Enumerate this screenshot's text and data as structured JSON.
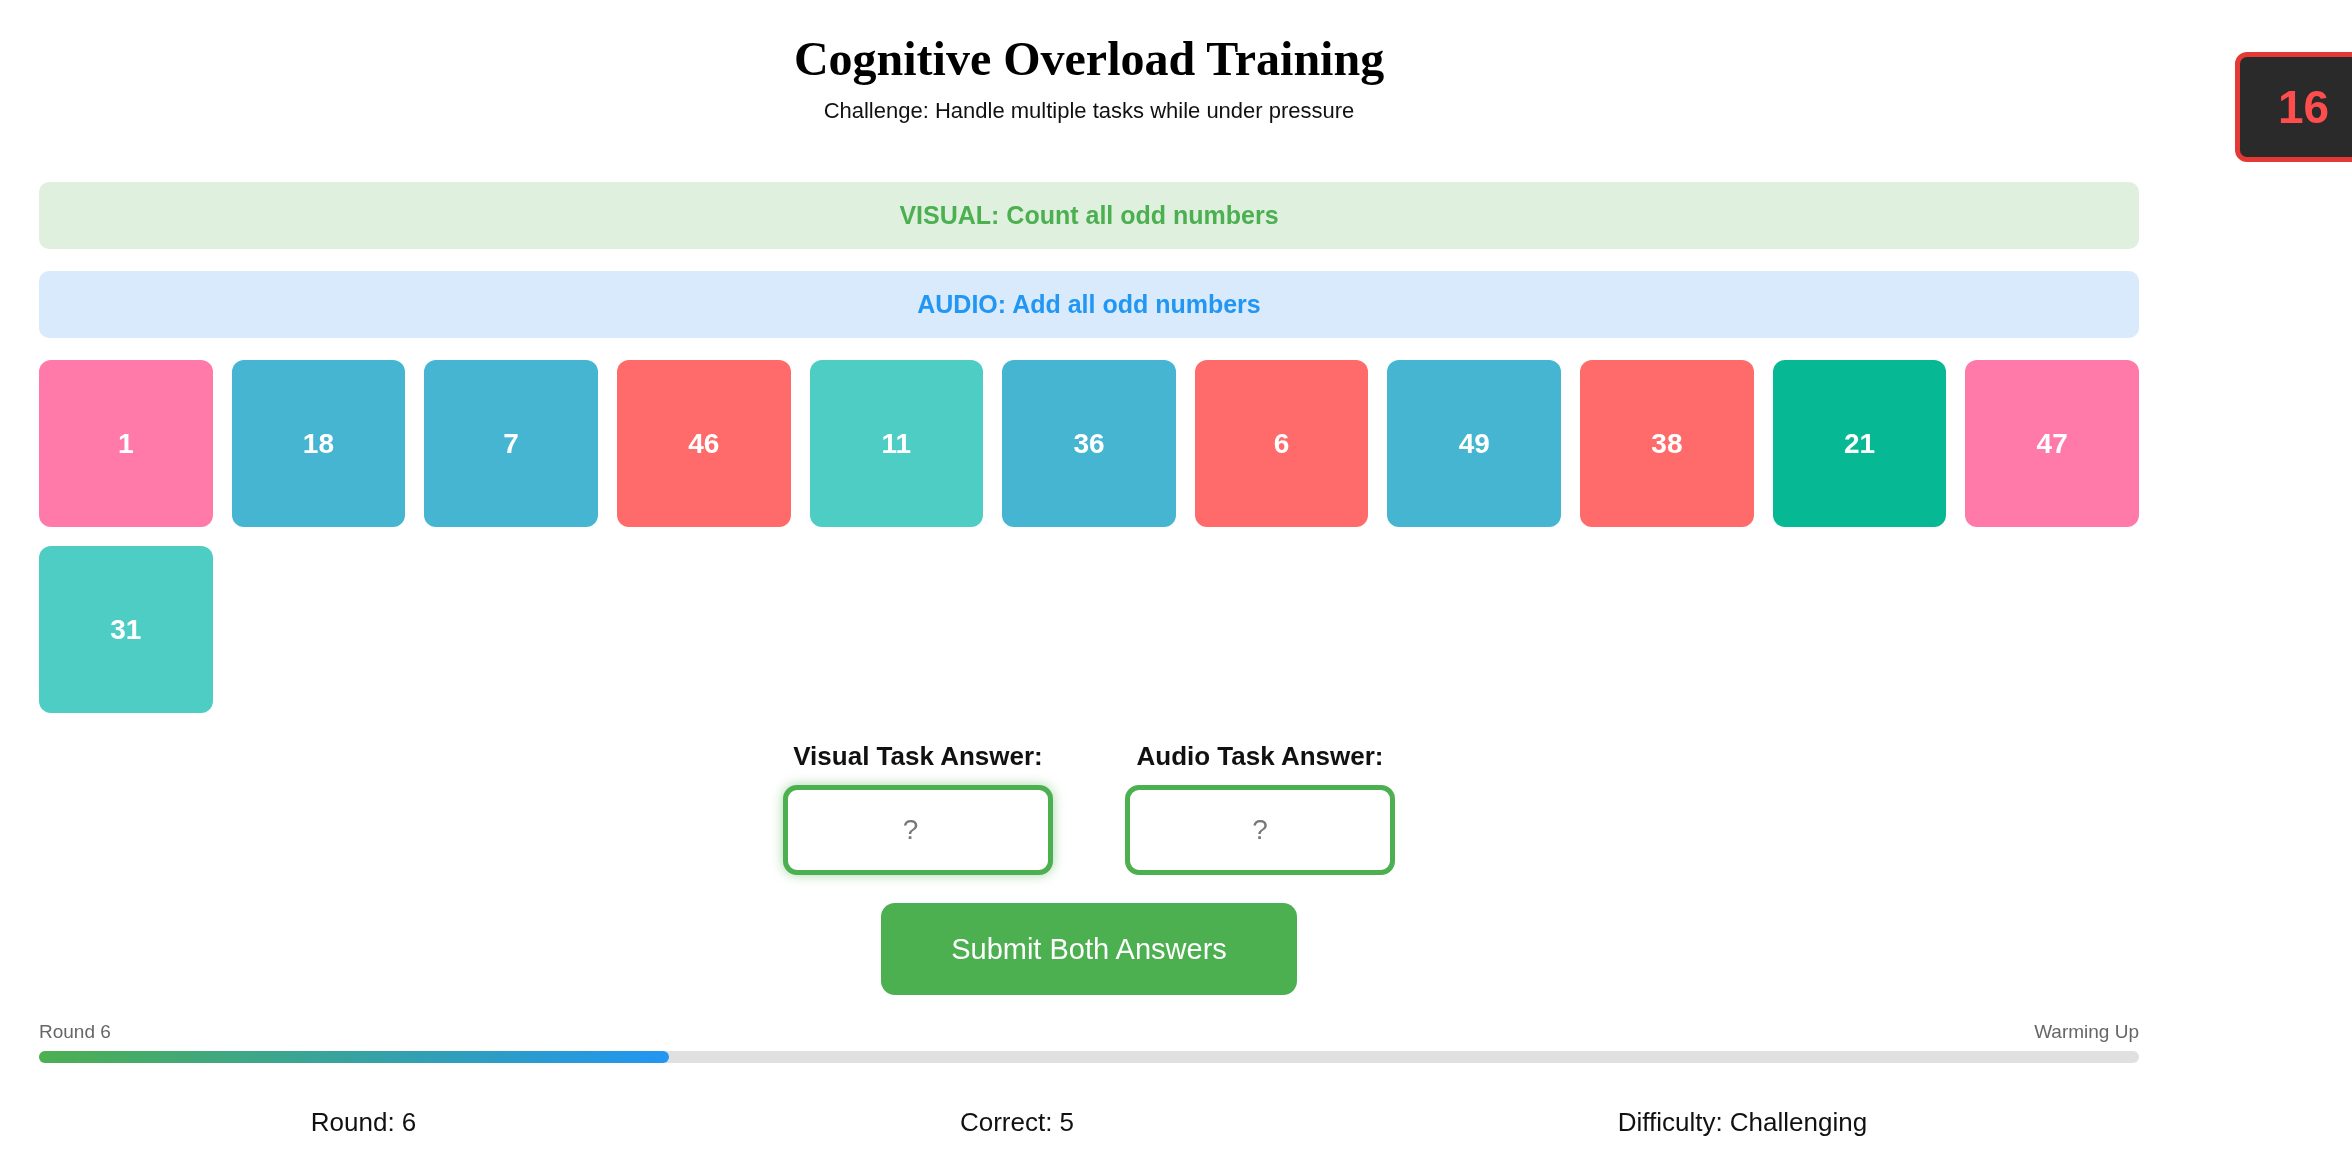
{
  "title": "Cognitive Overload Training",
  "subtitle": "Challenge: Handle multiple tasks while under pressure",
  "timer": "16",
  "tasks": [
    {
      "kind": "visual",
      "text": "VISUAL: Count all odd numbers"
    },
    {
      "kind": "audio",
      "text": "AUDIO: Add all odd numbers"
    }
  ],
  "tiles": [
    {
      "label": "1",
      "color": "#ff7aa8"
    },
    {
      "label": "18",
      "color": "#45b5d1"
    },
    {
      "label": "7",
      "color": "#45b5d1"
    },
    {
      "label": "46",
      "color": "#ff6b6b"
    },
    {
      "label": "11",
      "color": "#4ecdc4"
    },
    {
      "label": "36",
      "color": "#45b5d1"
    },
    {
      "label": "6",
      "color": "#ff6b6b"
    },
    {
      "label": "49",
      "color": "#45b5d1"
    },
    {
      "label": "38",
      "color": "#ff6b6b"
    },
    {
      "label": "21",
      "color": "#06b894"
    },
    {
      "label": "47",
      "color": "#ff7aa8"
    },
    {
      "label": "31",
      "color": "#4ecdc4"
    }
  ],
  "answers": [
    {
      "label": "Visual Task Answer:",
      "placeholder": "?",
      "focused": true
    },
    {
      "label": "Audio Task Answer:",
      "placeholder": "?",
      "focused": false
    }
  ],
  "submit_button": "Submit Both Answers",
  "progress": {
    "left_label": "Round 6",
    "right_label": "Warming Up",
    "level": 0.3
  },
  "stats": [
    "Round: 6",
    "Correct: 5",
    "Difficulty: Challenging"
  ]
}
